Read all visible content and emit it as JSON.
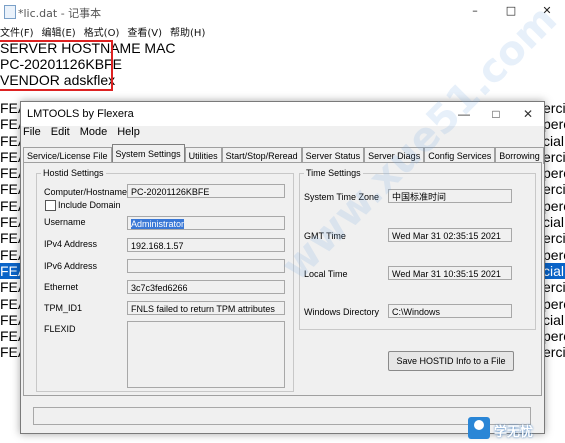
{
  "notepad": {
    "title": "*lic.dat - 记事本",
    "window_controls": [
      "–",
      "□",
      "✕"
    ],
    "menu": [
      "文件(F)",
      "编辑(E)",
      "格式(O)",
      "查看(V)",
      "帮助(H)"
    ],
    "lines": [
      "SERVER HOSTNAME MAC",
      "PC-20201126KBFE",
      "VENDOR adskflex"
    ],
    "left_col": [
      "FEA",
      "FEA",
      "FEA",
      "FEA",
      "FEA",
      "FEA",
      "FEA",
      "FEA",
      "FEA",
      "FEA",
      "FEA",
      "FEA",
      "FEA",
      "FEA",
      "FEA",
      "FEA"
    ],
    "right_col": [
      "ercia",
      "perc",
      "cial:",
      "ercia",
      "perc",
      "ercia",
      "perc",
      "cial:",
      "ercia",
      "perc",
      "cial:",
      "ercia",
      "perc",
      "cial:",
      "perc",
      "ercia"
    ],
    "selected_row_index": 10
  },
  "lmtools": {
    "title": "LMTOOLS by Flexera",
    "window_controls": [
      "—",
      "□",
      "✕"
    ],
    "menu": [
      "File",
      "Edit",
      "Mode",
      "Help"
    ],
    "tabs": [
      "Service/License File",
      "System Settings",
      "Utilities",
      "Start/Stop/Reread",
      "Server Status",
      "Server Diags",
      "Config Services",
      "Borrowing"
    ],
    "active_tab": "System Settings",
    "hostid": {
      "legend": "Hostid Settings",
      "computer_hostname_label": "Computer/Hostname",
      "computer_hostname_value": "PC-20201126KBFE",
      "include_domain_label": "Include Domain",
      "username_label": "Username",
      "username_value": "Administrator",
      "ipv4_label": "IPv4 Address",
      "ipv4_value": "192.168.1.57",
      "ipv6_label": "IPv6 Address",
      "ipv6_value": "",
      "ethernet_label": "Ethernet",
      "ethernet_value": "3c7c3fed6266",
      "tpm_label": "TPM_ID1",
      "tpm_value": "FNLS failed to return TPM attributes",
      "flexid_label": "FLEXID",
      "flexid_value": ""
    },
    "time": {
      "legend": "Time Settings",
      "zone_label": "System Time Zone",
      "zone_value": "中国标准时间",
      "gmt_label": "GMT Time",
      "gmt_value": "Wed Mar 31 02:35:15 2021",
      "local_label": "Local Time",
      "local_value": "Wed Mar 31 10:35:15 2021",
      "windir_label": "Windows Directory",
      "windir_value": "C:\\Windows"
    },
    "save_button": "Save HOSTID Info to a File"
  },
  "watermark": "www.xue51.com",
  "logo_text": "学无忧"
}
